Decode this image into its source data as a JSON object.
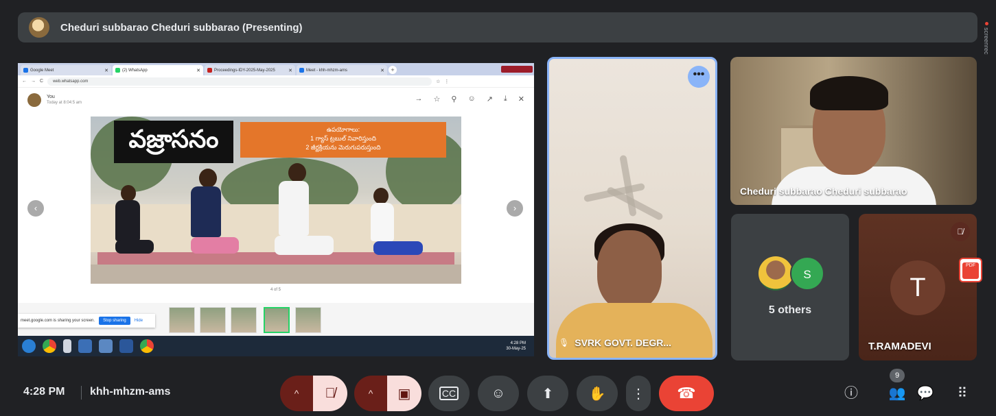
{
  "topbar": {
    "presenting_title": "Cheduri subbarao Cheduri subbarao (Presenting)"
  },
  "screenrec": {
    "label": "screenrec"
  },
  "shared_screen": {
    "tabs": [
      {
        "label": "Google Meet",
        "color": "#1a73e8"
      },
      {
        "label": "(2) WhatsApp",
        "color": "#25d366"
      },
      {
        "label": "Proceedings-IDY-2025-May-2025",
        "color": "#c5221f"
      },
      {
        "label": "Meet - khh-mhzm-ams",
        "color": "#1a73e8"
      }
    ],
    "url": "web.whatsapp.com",
    "sender_name": "You",
    "sender_time": "Today at 8:04:5 am",
    "slide_title": "వజ్రాసనం",
    "slide_benefits_heading": "ఉపయోగాలు:",
    "slide_benefit_1": "1 గ్యాస్ ట్రబుల్ నివారిస్తుంది",
    "slide_benefit_2": "2 జీర్ణక్రియను మెరుగుపరుస్తుంది",
    "slide_counter": "4 of 5",
    "share_notice": "meet.google.com is sharing your screen.",
    "stop_sharing": "Stop sharing",
    "hide": "Hide",
    "tray_time": "4:28 PM",
    "tray_date": "30-May-25"
  },
  "participants": {
    "svrk": {
      "name": "SVRK GOVT. DEGR..."
    },
    "cheduri": {
      "name": "Cheduri subbarao Cheduri subbarao"
    },
    "others": {
      "avatar_letter": "S",
      "label": "5 others"
    },
    "ramadevi": {
      "avatar_letter": "T",
      "name": "T.RAMADEVI"
    }
  },
  "pdf_badge": "PDF",
  "bottombar": {
    "time": "4:28 PM",
    "meeting_code": "khh-mhzm-ams",
    "people_count": "9"
  },
  "colors": {
    "accent": "#8ab4f8",
    "end_call": "#ea4335",
    "mic_off_bg": "#f9dedc"
  }
}
